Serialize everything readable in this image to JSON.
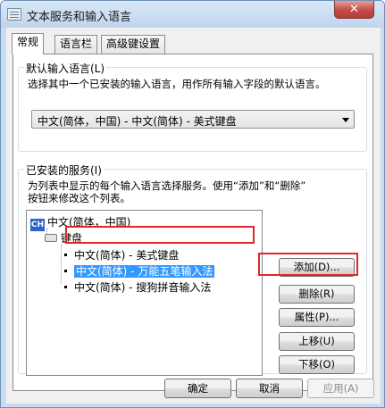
{
  "window": {
    "title": "文本服务和输入语言",
    "close_label": "✕"
  },
  "tabs": [
    {
      "label": "常规",
      "active": true
    },
    {
      "label": "语言栏",
      "active": false
    },
    {
      "label": "高级键设置",
      "active": false
    }
  ],
  "default_language": {
    "group_label": "默认输入语言(L)",
    "description": "选择其中一个已安装的输入语言，用作所有输入字段的默认语言。",
    "selected": "中文(简体，中国) - 中文(简体) - 美式键盘"
  },
  "installed_services": {
    "group_label": "已安装的服务(I)",
    "description_line1": "为列表中显示的每个输入语言选择服务。使用“添加”和“删除”",
    "description_line2": "按钮来修改这个列表。",
    "language_badge": "CH",
    "language": "中文(简体，中国)",
    "category": "键盘",
    "items": [
      {
        "label": "中文(简体) - 美式键盘",
        "selected": false
      },
      {
        "label": "中文(简体) - 万能五笔输入法",
        "selected": true
      },
      {
        "label": "中文(简体) - 搜狗拼音输入法",
        "selected": false
      }
    ]
  },
  "side_buttons": {
    "add": "添加(D)...",
    "remove": "删除(R)",
    "properties": "属性(P)...",
    "move_up": "上移(U)",
    "move_down": "下移(O)"
  },
  "bottom_buttons": {
    "ok": "确定",
    "cancel": "取消",
    "apply": "应用(A)"
  },
  "colors": {
    "selection": "#3399ff",
    "highlight_box": "#e0262b",
    "title_bar": "#c9dcf0",
    "close_button": "#c75050"
  },
  "icons": [
    "window-icon",
    "close-icon",
    "chevron-down-icon",
    "language-badge-icon",
    "keyboard-icon"
  ]
}
